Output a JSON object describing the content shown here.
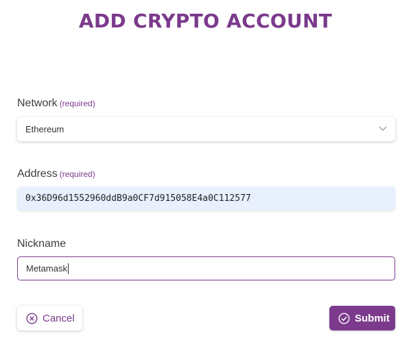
{
  "page": {
    "title": "ADD CRYPTO ACCOUNT"
  },
  "network": {
    "label": "Network",
    "required": "(required)",
    "selected": "Ethereum"
  },
  "address": {
    "label": "Address",
    "required": "(required)",
    "value": "0x36D96d1552960ddB9a0CF7d915058E4a0C112577"
  },
  "nickname": {
    "label": "Nickname",
    "value": "Metamask"
  },
  "buttons": {
    "cancel": "Cancel",
    "submit": "Submit"
  },
  "colors": {
    "accent": "#7b3a8c",
    "address_bg": "#e8f0fe"
  }
}
